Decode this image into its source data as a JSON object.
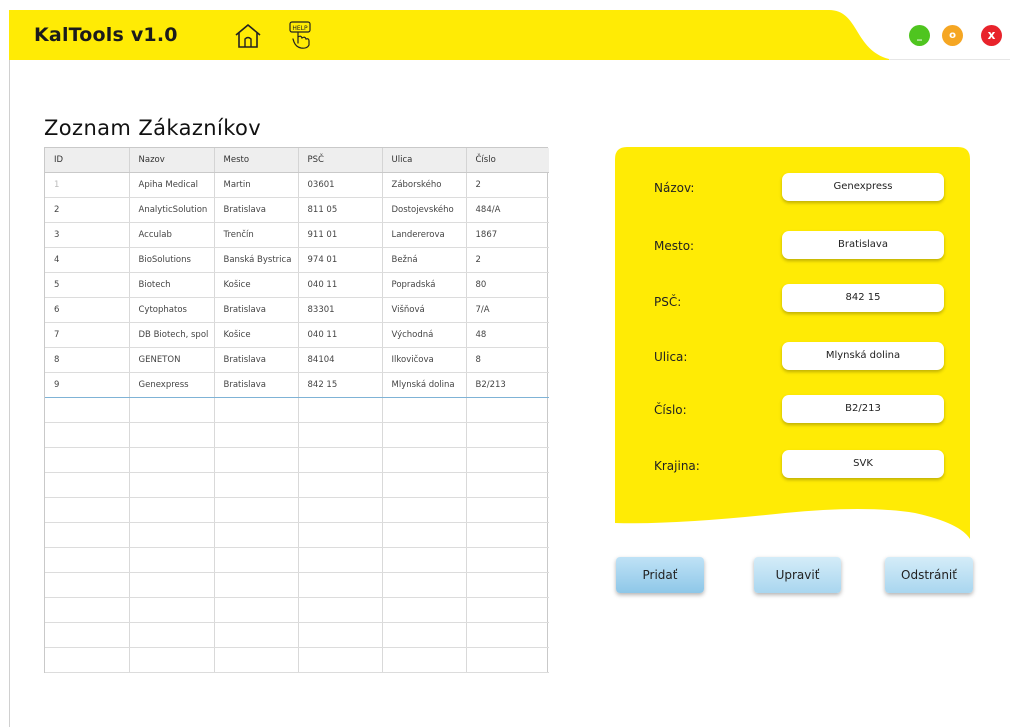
{
  "app": {
    "title": "KalTools v1.0",
    "help_icon_text": "HELP",
    "window_buttons": {
      "minimize": "_",
      "maximize": "o",
      "close": "x"
    }
  },
  "page_title": "Zoznam Zákazníkov",
  "table": {
    "columns": [
      "ID",
      "Nazov",
      "Mesto",
      "PSČ",
      "Ulica",
      "Číslo"
    ],
    "rows": [
      [
        "1",
        "Apiha Medical",
        "Martin",
        "03601",
        "Záborského",
        "2"
      ],
      [
        "2",
        "AnalyticSolution",
        "Bratislava",
        "811 05",
        "Dostojevského",
        "484/A"
      ],
      [
        "3",
        "Acculab",
        "Trenčín",
        "911 01",
        "Landererova",
        "1867"
      ],
      [
        "4",
        "BioSolutions",
        "Banská Bystrica",
        "974 01",
        "Bežná",
        "2"
      ],
      [
        "5",
        "Biotech",
        "Košice",
        "040 11",
        "Popradská",
        "80"
      ],
      [
        "6",
        "Cytophatos",
        "Bratislava",
        "83301",
        "Višňová",
        "7/A"
      ],
      [
        "7",
        "DB Biotech, spol",
        "Košice",
        "040 11",
        "Východná",
        "48"
      ],
      [
        "8",
        "GENETON",
        "Bratislava",
        "84104",
        "Ilkovičova",
        "8"
      ],
      [
        "9",
        "Genexpress",
        "Bratislava",
        "842 15",
        "Mlynská dolina",
        "B2/213"
      ]
    ],
    "selected_row": 9
  },
  "form": {
    "nazov": {
      "label": "Názov:",
      "value": "Genexpress"
    },
    "mesto": {
      "label": "Mesto:",
      "value": "Bratislava"
    },
    "psc": {
      "label": "PSČ:",
      "value": "842 15"
    },
    "ulica": {
      "label": "Ulica:",
      "value": "Mlynská dolina"
    },
    "cislo": {
      "label": "Číslo:",
      "value": "B2/213"
    },
    "krajina": {
      "label": "Krajina:",
      "value": "SVK"
    }
  },
  "actions": {
    "add": "Pridať",
    "edit": "Upraviť",
    "remove": "Odstrániť"
  },
  "colors": {
    "accent_yellow": "#ffeb05",
    "button_blue": "#a9d6ef",
    "minimize_green": "#4fc51f",
    "maximize_orange": "#f5a623",
    "close_red": "#e8232b"
  },
  "icons": [
    "home-icon",
    "help-hand-icon"
  ]
}
